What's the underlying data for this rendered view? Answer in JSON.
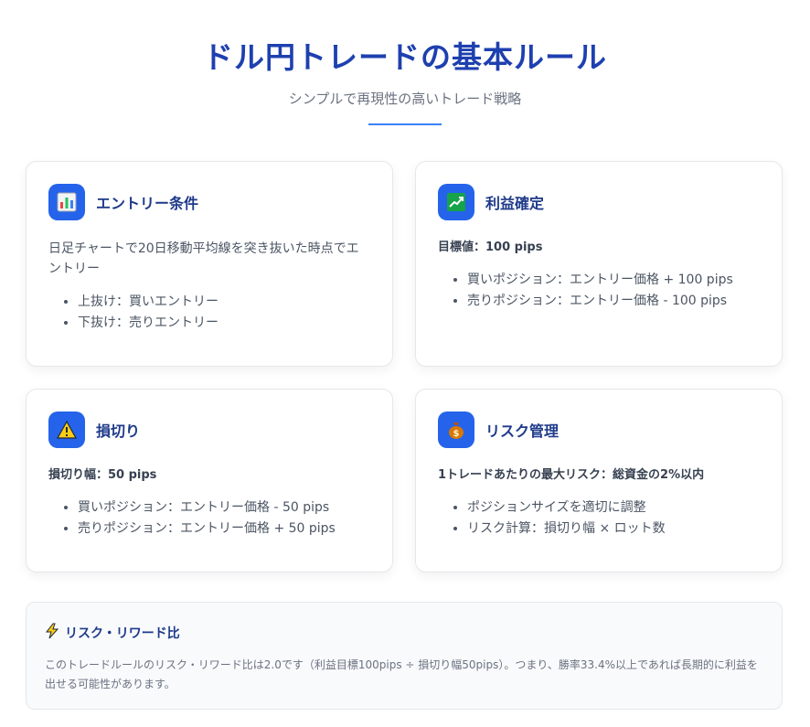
{
  "header": {
    "title": "ドル円トレードの基本ルール",
    "subtitle": "シンプルで再現性の高いトレード戦略"
  },
  "cards": {
    "entry": {
      "icon": "bar-chart-icon",
      "title": "エントリー条件",
      "text": "日足チャートで20日移動平均線を突き抜いた時点でエントリー",
      "bullets": [
        "上抜け：買いエントリー",
        "下抜け：売りエントリー"
      ]
    },
    "profit": {
      "icon": "trending-up-chart-icon",
      "title": "利益確定",
      "strong": "目標値：100 pips",
      "bullets": [
        "買いポジション：エントリー価格 + 100 pips",
        "売りポジション：エントリー価格 - 100 pips"
      ]
    },
    "stoploss": {
      "icon": "warning-icon",
      "title": "損切り",
      "strong": "損切り幅：50 pips",
      "bullets": [
        "買いポジション：エントリー価格 - 50 pips",
        "売りポジション：エントリー価格 + 50 pips"
      ]
    },
    "risk": {
      "icon": "money-bag-icon",
      "title": "リスク管理",
      "strong": "1トレードあたりの最大リスク：総資金の2%以内",
      "bullets": [
        "ポジションサイズを適切に調整",
        "リスク計算：損切り幅 × ロット数"
      ]
    }
  },
  "note": {
    "icon": "lightning-icon",
    "title": "リスク・リワード比",
    "text": "このトレードルールのリスク・リワード比は2.0です（利益目標100pips ÷ 損切り幅50pips）。つまり、勝率33.4%以上であれば長期的に利益を出せる可能性があります。"
  },
  "colors": {
    "accent": "#2563eb",
    "title": "#1e40af",
    "card_title": "#1e3a8a"
  }
}
